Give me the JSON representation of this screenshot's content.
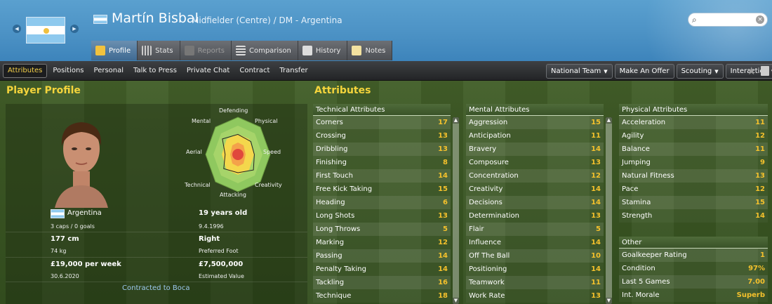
{
  "header": {
    "player_name": "Martín Bisbal",
    "player_role": "Midfielder (Centre) / DM - Argentina",
    "search_placeholder": ""
  },
  "tabs": [
    {
      "label": "Profile",
      "active": true
    },
    {
      "label": "Stats"
    },
    {
      "label": "Reports",
      "disabled": true
    },
    {
      "label": "Comparison"
    },
    {
      "label": "History"
    },
    {
      "label": "Notes"
    }
  ],
  "subnav": {
    "items": [
      "Attributes",
      "Positions",
      "Personal",
      "Talk to Press",
      "Private Chat",
      "Contract",
      "Transfer"
    ],
    "buttons": [
      "National Team",
      "Make An Offer",
      "Scouting",
      "Interaction"
    ]
  },
  "profile": {
    "title": "Player Profile",
    "nationality": "Argentina",
    "caps": "3 caps / 0 goals",
    "age": "19 years old",
    "dob": "9.4.1996",
    "height": "177 cm",
    "foot": "Right",
    "weight": "74 kg",
    "foot_label": "Preferred Foot",
    "wage": "£19,000 per week",
    "value": "£7,500,000",
    "contract_end": "30.6.2020",
    "value_label": "Estimated Value",
    "contract": "Contracted to Boca"
  },
  "radar": {
    "labels": [
      "Defending",
      "Physical",
      "Speed",
      "Creativity",
      "Attacking",
      "Technical",
      "Aerial",
      "Mental"
    ],
    "values": [
      0.55,
      0.5,
      0.45,
      0.6,
      0.5,
      0.55,
      0.35,
      0.6
    ]
  },
  "attributes": {
    "title": "Attributes",
    "technical": {
      "header": "Technical Attributes",
      "rows": [
        {
          "name": "Corners",
          "value": "17"
        },
        {
          "name": "Crossing",
          "value": "13"
        },
        {
          "name": "Dribbling",
          "value": "13"
        },
        {
          "name": "Finishing",
          "value": "8"
        },
        {
          "name": "First Touch",
          "value": "14"
        },
        {
          "name": "Free Kick Taking",
          "value": "15"
        },
        {
          "name": "Heading",
          "value": "6"
        },
        {
          "name": "Long Shots",
          "value": "13"
        },
        {
          "name": "Long Throws",
          "value": "5"
        },
        {
          "name": "Marking",
          "value": "12"
        },
        {
          "name": "Passing",
          "value": "14"
        },
        {
          "name": "Penalty Taking",
          "value": "14"
        },
        {
          "name": "Tackling",
          "value": "16"
        },
        {
          "name": "Technique",
          "value": "18"
        }
      ]
    },
    "mental": {
      "header": "Mental Attributes",
      "rows": [
        {
          "name": "Aggression",
          "value": "15"
        },
        {
          "name": "Anticipation",
          "value": "11"
        },
        {
          "name": "Bravery",
          "value": "14"
        },
        {
          "name": "Composure",
          "value": "13"
        },
        {
          "name": "Concentration",
          "value": "12"
        },
        {
          "name": "Creativity",
          "value": "14"
        },
        {
          "name": "Decisions",
          "value": "14"
        },
        {
          "name": "Determination",
          "value": "13"
        },
        {
          "name": "Flair",
          "value": "5"
        },
        {
          "name": "Influence",
          "value": "14"
        },
        {
          "name": "Off The Ball",
          "value": "10"
        },
        {
          "name": "Positioning",
          "value": "14"
        },
        {
          "name": "Teamwork",
          "value": "11"
        },
        {
          "name": "Work Rate",
          "value": "13"
        }
      ]
    },
    "physical": {
      "header": "Physical Attributes",
      "rows": [
        {
          "name": "Acceleration",
          "value": "11"
        },
        {
          "name": "Agility",
          "value": "12"
        },
        {
          "name": "Balance",
          "value": "11"
        },
        {
          "name": "Jumping",
          "value": "9"
        },
        {
          "name": "Natural Fitness",
          "value": "13"
        },
        {
          "name": "Pace",
          "value": "12"
        },
        {
          "name": "Stamina",
          "value": "15"
        },
        {
          "name": "Strength",
          "value": "14"
        }
      ]
    },
    "other": {
      "header": "Other",
      "rows": [
        {
          "name": "Goalkeeper Rating",
          "value": "1"
        },
        {
          "name": "Condition",
          "value": "97%"
        },
        {
          "name": "Last 5 Games",
          "value": "7.00"
        },
        {
          "name": "Int. Morale",
          "value": "Superb"
        }
      ]
    }
  },
  "colors": {
    "accent_yellow": "#f4c12c",
    "header_blue": "#4c92c5",
    "link_blue": "#9cc8ee"
  }
}
